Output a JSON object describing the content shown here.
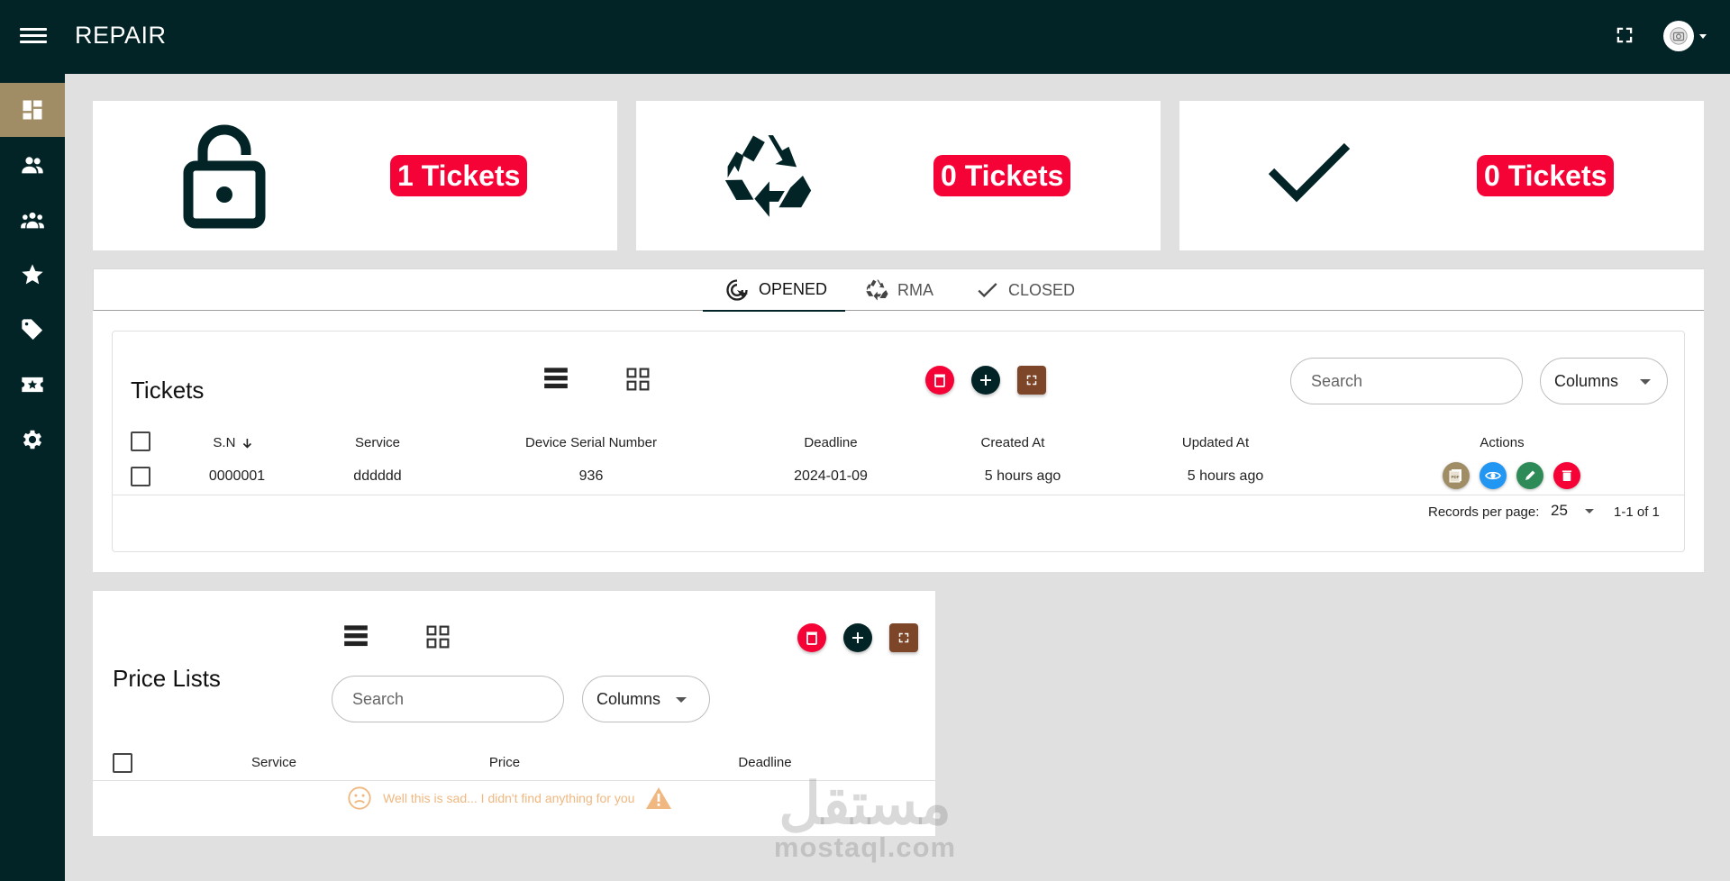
{
  "header": {
    "title": "REPAIR"
  },
  "sidebar": {
    "items": [
      {
        "name": "dashboard",
        "icon": "dashboard-icon",
        "active": true
      },
      {
        "name": "users",
        "icon": "people-icon"
      },
      {
        "name": "groups",
        "icon": "groups-icon"
      },
      {
        "name": "favorites",
        "icon": "star-icon"
      },
      {
        "name": "tags",
        "icon": "tag-icon"
      },
      {
        "name": "tickets",
        "icon": "ticket-star-icon"
      },
      {
        "name": "settings",
        "icon": "gear-icon"
      }
    ]
  },
  "stats": [
    {
      "icon": "lock-open-icon",
      "label": "1 Tickets"
    },
    {
      "icon": "recycle-icon",
      "label": "0 Tickets"
    },
    {
      "icon": "check-icon",
      "label": "0 Tickets"
    }
  ],
  "tabs": [
    {
      "label": "OPENED",
      "icon": "radar-icon",
      "active": true
    },
    {
      "label": "RMA",
      "icon": "recycle-icon"
    },
    {
      "label": "CLOSED",
      "icon": "check-icon"
    }
  ],
  "tickets": {
    "title": "Tickets",
    "search_placeholder": "Search",
    "columns_label": "Columns",
    "headers": {
      "sn": "S.N",
      "service": "Service",
      "serial": "Device Serial Number",
      "deadline": "Deadline",
      "created": "Created At",
      "updated": "Updated At",
      "actions": "Actions"
    },
    "rows": [
      {
        "sn": "0000001",
        "service": "dddddd",
        "serial": "936",
        "deadline": "2024-01-09",
        "created": "5 hours ago",
        "updated": "5 hours ago"
      }
    ],
    "footer": {
      "records_label": "Records per page:",
      "records_value": "25",
      "range": "1-1 of 1"
    }
  },
  "price_lists": {
    "title": "Price Lists",
    "search_placeholder": "Search",
    "columns_label": "Columns",
    "headers": {
      "service": "Service",
      "price": "Price",
      "deadline": "Deadline"
    },
    "empty_message": "Well this is sad... I didn't find anything for you"
  },
  "watermark": {
    "arabic": "مستقل",
    "latin": "mostaql.com"
  },
  "colors": {
    "primary": "#032426",
    "accent": "#a08d66",
    "badge": "#f50336",
    "brown": "#7e4628",
    "view": "#2196f3",
    "edit": "#2e8b57",
    "pdf": "#a08d66",
    "empty": "#f0b880"
  }
}
